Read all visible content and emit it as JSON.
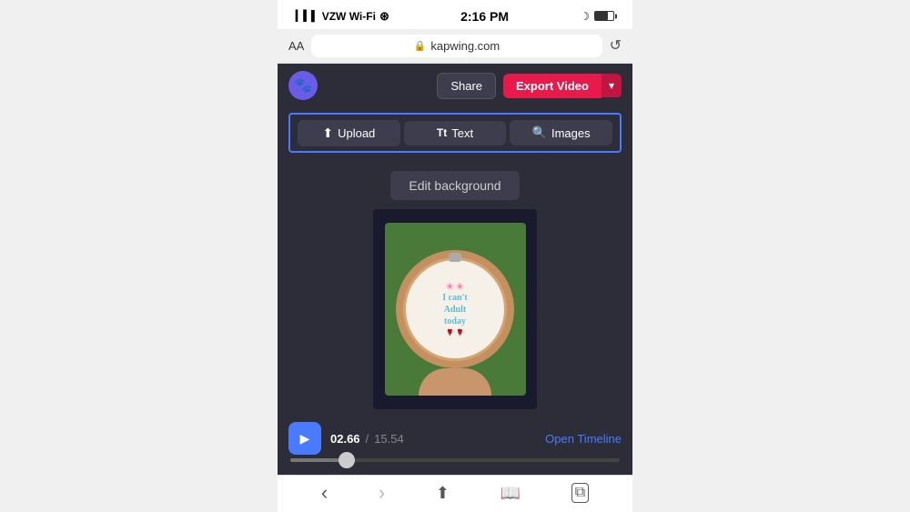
{
  "status_bar": {
    "signal": "▎▍▌",
    "carrier": "VZW Wi-Fi",
    "wifi": "wifi",
    "time": "2:16 PM",
    "battery_icon": "battery"
  },
  "browser": {
    "aa_label": "AA",
    "url": "kapwing.com",
    "refresh_symbol": "↺"
  },
  "app_header": {
    "logo_initial": "🐾",
    "share_label": "Share",
    "export_label": "Export Video",
    "export_dropdown_symbol": "▾"
  },
  "toolbar": {
    "upload_label": "Upload",
    "text_label": "Text",
    "images_label": "Images",
    "upload_icon": "⬆",
    "text_icon": "Tt",
    "images_icon": "🔍"
  },
  "content": {
    "edit_background_label": "Edit background",
    "hoop_line1": "I can't",
    "hoop_line2": "Adult",
    "hoop_line3": "today"
  },
  "timeline": {
    "play_icon": "▶",
    "time_current": "02.66",
    "time_separator": "/",
    "time_total": "15.54",
    "open_timeline_label": "Open Timeline"
  },
  "bottom_nav": {
    "back_symbol": "‹",
    "forward_symbol": "›",
    "share_symbol": "⬆",
    "book_symbol": "📖",
    "copy_symbol": "⧉"
  }
}
